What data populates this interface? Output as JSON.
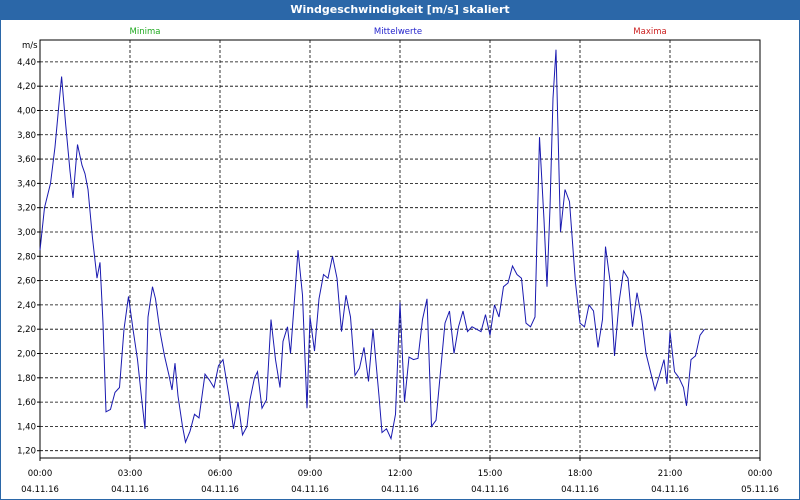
{
  "window": {
    "title": "Windgeschwindigkeit [m/s] skaliert"
  },
  "legend": {
    "min": "Minima",
    "mean": "Mittelwerte",
    "max": "Maxima"
  },
  "colors": {
    "min": "#22aa22",
    "mean": "#2222cc",
    "max": "#cc2222",
    "line": "#1a1ab0",
    "title_bg": "#2b67a8"
  },
  "chart_data": {
    "type": "line",
    "ylabel": "m/s",
    "ylim": [
      1.14,
      4.58
    ],
    "xlim": [
      0,
      24
    ],
    "grid": true,
    "yticks": [
      {
        "v": 1.2,
        "label": "1,20"
      },
      {
        "v": 1.4,
        "label": "1,40"
      },
      {
        "v": 1.6,
        "label": "1,60"
      },
      {
        "v": 1.8,
        "label": "1,80"
      },
      {
        "v": 2.0,
        "label": "2,00"
      },
      {
        "v": 2.2,
        "label": "2,20"
      },
      {
        "v": 2.4,
        "label": "2,40"
      },
      {
        "v": 2.6,
        "label": "2,60"
      },
      {
        "v": 2.8,
        "label": "2,80"
      },
      {
        "v": 3.0,
        "label": "3,00"
      },
      {
        "v": 3.2,
        "label": "3,20"
      },
      {
        "v": 3.4,
        "label": "3,40"
      },
      {
        "v": 3.6,
        "label": "3,60"
      },
      {
        "v": 3.8,
        "label": "3,80"
      },
      {
        "v": 4.0,
        "label": "4,00"
      },
      {
        "v": 4.2,
        "label": "4,20"
      },
      {
        "v": 4.4,
        "label": "4,40"
      }
    ],
    "xticks": [
      {
        "v": 0,
        "time": "00:00",
        "date": "04.11.16"
      },
      {
        "v": 3,
        "time": "03:00",
        "date": "04.11.16"
      },
      {
        "v": 6,
        "time": "06:00",
        "date": "04.11.16"
      },
      {
        "v": 9,
        "time": "09:00",
        "date": "04.11.16"
      },
      {
        "v": 12,
        "time": "12:00",
        "date": "04.11.16"
      },
      {
        "v": 15,
        "time": "15:00",
        "date": "04.11.16"
      },
      {
        "v": 18,
        "time": "18:00",
        "date": "04.11.16"
      },
      {
        "v": 21,
        "time": "21:00",
        "date": "04.11.16"
      },
      {
        "v": 24,
        "time": "00:00",
        "date": "05.11.16"
      }
    ],
    "series": [
      {
        "name": "Mittelwerte",
        "points": [
          [
            0.0,
            2.85
          ],
          [
            0.15,
            3.2
          ],
          [
            0.35,
            3.4
          ],
          [
            0.5,
            3.7
          ],
          [
            0.65,
            4.1
          ],
          [
            0.72,
            4.28
          ],
          [
            0.85,
            3.9
          ],
          [
            1.0,
            3.5
          ],
          [
            1.1,
            3.28
          ],
          [
            1.25,
            3.72
          ],
          [
            1.4,
            3.55
          ],
          [
            1.5,
            3.48
          ],
          [
            1.6,
            3.35
          ],
          [
            1.75,
            2.95
          ],
          [
            1.9,
            2.62
          ],
          [
            2.0,
            2.75
          ],
          [
            2.1,
            2.25
          ],
          [
            2.2,
            1.52
          ],
          [
            2.35,
            1.54
          ],
          [
            2.5,
            1.68
          ],
          [
            2.65,
            1.72
          ],
          [
            2.8,
            2.2
          ],
          [
            2.95,
            2.47
          ],
          [
            3.1,
            2.2
          ],
          [
            3.25,
            1.95
          ],
          [
            3.4,
            1.6
          ],
          [
            3.5,
            1.38
          ],
          [
            3.6,
            2.3
          ],
          [
            3.75,
            2.55
          ],
          [
            3.85,
            2.45
          ],
          [
            4.0,
            2.18
          ],
          [
            4.15,
            1.98
          ],
          [
            4.3,
            1.82
          ],
          [
            4.4,
            1.7
          ],
          [
            4.5,
            1.92
          ],
          [
            4.6,
            1.65
          ],
          [
            4.75,
            1.4
          ],
          [
            4.85,
            1.27
          ],
          [
            5.0,
            1.36
          ],
          [
            5.15,
            1.5
          ],
          [
            5.3,
            1.47
          ],
          [
            5.5,
            1.83
          ],
          [
            5.65,
            1.78
          ],
          [
            5.8,
            1.72
          ],
          [
            5.95,
            1.9
          ],
          [
            6.1,
            1.95
          ],
          [
            6.3,
            1.65
          ],
          [
            6.45,
            1.38
          ],
          [
            6.6,
            1.6
          ],
          [
            6.75,
            1.33
          ],
          [
            6.9,
            1.4
          ],
          [
            7.0,
            1.62
          ],
          [
            7.15,
            1.8
          ],
          [
            7.25,
            1.85
          ],
          [
            7.4,
            1.55
          ],
          [
            7.55,
            1.62
          ],
          [
            7.7,
            2.28
          ],
          [
            7.85,
            1.95
          ],
          [
            8.0,
            1.72
          ],
          [
            8.1,
            2.1
          ],
          [
            8.25,
            2.22
          ],
          [
            8.35,
            2.0
          ],
          [
            8.5,
            2.5
          ],
          [
            8.6,
            2.85
          ],
          [
            8.75,
            2.48
          ],
          [
            8.9,
            1.55
          ],
          [
            9.0,
            2.3
          ],
          [
            9.15,
            2.02
          ],
          [
            9.3,
            2.45
          ],
          [
            9.45,
            2.65
          ],
          [
            9.6,
            2.62
          ],
          [
            9.75,
            2.8
          ],
          [
            9.9,
            2.62
          ],
          [
            10.05,
            2.18
          ],
          [
            10.2,
            2.48
          ],
          [
            10.35,
            2.3
          ],
          [
            10.5,
            1.82
          ],
          [
            10.65,
            1.88
          ],
          [
            10.8,
            2.05
          ],
          [
            10.95,
            1.77
          ],
          [
            11.1,
            2.2
          ],
          [
            11.3,
            1.65
          ],
          [
            11.4,
            1.35
          ],
          [
            11.55,
            1.38
          ],
          [
            11.7,
            1.3
          ],
          [
            11.85,
            1.5
          ],
          [
            12.0,
            2.42
          ],
          [
            12.15,
            1.6
          ],
          [
            12.3,
            1.97
          ],
          [
            12.45,
            1.95
          ],
          [
            12.6,
            1.96
          ],
          [
            12.75,
            2.28
          ],
          [
            12.9,
            2.45
          ],
          [
            13.05,
            1.4
          ],
          [
            13.2,
            1.45
          ],
          [
            13.35,
            1.85
          ],
          [
            13.5,
            2.25
          ],
          [
            13.65,
            2.35
          ],
          [
            13.8,
            2.0
          ],
          [
            13.95,
            2.22
          ],
          [
            14.1,
            2.35
          ],
          [
            14.25,
            2.18
          ],
          [
            14.4,
            2.22
          ],
          [
            14.55,
            2.2
          ],
          [
            14.7,
            2.18
          ],
          [
            14.85,
            2.32
          ],
          [
            15.0,
            2.15
          ],
          [
            15.15,
            2.4
          ],
          [
            15.3,
            2.3
          ],
          [
            15.45,
            2.55
          ],
          [
            15.6,
            2.58
          ],
          [
            15.75,
            2.72
          ],
          [
            15.9,
            2.65
          ],
          [
            16.05,
            2.62
          ],
          [
            16.2,
            2.25
          ],
          [
            16.35,
            2.22
          ],
          [
            16.5,
            2.3
          ],
          [
            16.65,
            3.78
          ],
          [
            16.8,
            3.1
          ],
          [
            16.9,
            2.55
          ],
          [
            17.0,
            3.2
          ],
          [
            17.1,
            4.1
          ],
          [
            17.2,
            4.5
          ],
          [
            17.35,
            3.0
          ],
          [
            17.5,
            3.35
          ],
          [
            17.65,
            3.25
          ],
          [
            17.85,
            2.58
          ],
          [
            18.0,
            2.25
          ],
          [
            18.15,
            2.22
          ],
          [
            18.3,
            2.4
          ],
          [
            18.45,
            2.35
          ],
          [
            18.6,
            2.05
          ],
          [
            18.75,
            2.28
          ],
          [
            18.85,
            2.88
          ],
          [
            19.0,
            2.6
          ],
          [
            19.15,
            1.98
          ],
          [
            19.3,
            2.42
          ],
          [
            19.45,
            2.68
          ],
          [
            19.6,
            2.62
          ],
          [
            19.75,
            2.22
          ],
          [
            19.9,
            2.5
          ],
          [
            20.05,
            2.3
          ],
          [
            20.2,
            2.0
          ],
          [
            20.35,
            1.85
          ],
          [
            20.5,
            1.7
          ],
          [
            20.65,
            1.82
          ],
          [
            20.8,
            1.95
          ],
          [
            20.9,
            1.75
          ],
          [
            21.0,
            2.18
          ],
          [
            21.15,
            1.85
          ],
          [
            21.3,
            1.8
          ],
          [
            21.45,
            1.72
          ],
          [
            21.55,
            1.57
          ],
          [
            21.7,
            1.95
          ],
          [
            21.85,
            1.98
          ],
          [
            22.0,
            2.15
          ],
          [
            22.15,
            2.2
          ]
        ]
      }
    ]
  }
}
